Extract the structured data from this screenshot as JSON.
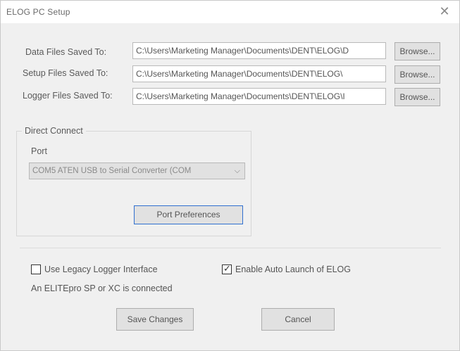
{
  "window": {
    "title": "ELOG PC Setup",
    "close_glyph": "✕"
  },
  "rows": [
    {
      "label": "Data Files Saved To:",
      "path": "C:\\Users\\Marketing Manager\\Documents\\DENT\\ELOG\\D",
      "browse": "Browse..."
    },
    {
      "label": "Setup Files Saved To:",
      "path": "C:\\Users\\Marketing Manager\\Documents\\DENT\\ELOG\\",
      "browse": "Browse..."
    },
    {
      "label": "Logger Files Saved To:",
      "path": "C:\\Users\\Marketing Manager\\Documents\\DENT\\ELOG\\I",
      "browse": "Browse..."
    }
  ],
  "direct_connect": {
    "group_label": "Direct Connect",
    "port_label": "Port",
    "port_value": "COM5 ATEN USB to Serial Converter (COM",
    "chevron_glyph": "⌵",
    "preferences_button": "Port Preferences"
  },
  "options": {
    "legacy_label": "Use Legacy Logger Interface",
    "legacy_checked": false,
    "legacy_note": "An ELITEpro SP or XC is connected",
    "autolaunch_label": "Enable Auto Launch of ELOG",
    "autolaunch_checked": true,
    "check_glyph": "✓"
  },
  "footer": {
    "save": "Save Changes",
    "cancel": "Cancel"
  }
}
